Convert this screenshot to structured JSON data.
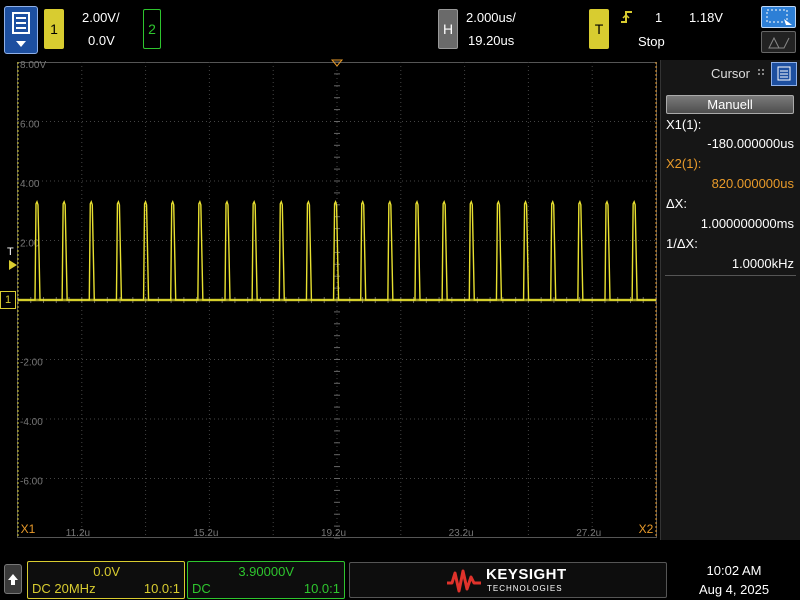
{
  "top": {
    "ch1": {
      "number": "1",
      "scale": "2.00V/",
      "offset": "0.0V"
    },
    "ch2": {
      "number": "2"
    },
    "horizontal": {
      "label": "H",
      "scale": "2.000us/",
      "delay": "19.20us"
    },
    "trigger": {
      "label": "T",
      "source": "1",
      "level": "1.18V",
      "status": "Stop"
    }
  },
  "screen": {
    "y_labels": [
      "8.00V",
      "6.00",
      "4.00",
      "2.00",
      "-2.00",
      "-4.00",
      "-6.00"
    ],
    "x_labels": [
      "11.2u",
      "15.2u",
      "19.2u",
      "23.2u",
      "27.2u"
    ],
    "marker_x1": "X1",
    "marker_x2": "X2",
    "trigger_marker": "T",
    "channel_marker": "1"
  },
  "panel": {
    "title": "Cursor",
    "mode_button": "Manuell",
    "x1_label": "X1(1):",
    "x1_value": "-180.000000us",
    "x2_label": "X2(1):",
    "x2_value": "820.000000us",
    "dx_label": "ΔX:",
    "dx_value": "1.000000000ms",
    "inv_dx_label": "1/ΔX:",
    "inv_dx_value": "1.0000kHz"
  },
  "bottom": {
    "ch1": {
      "offset": "0.0V",
      "coupling": "DC 20MHz",
      "probe": "10.0:1"
    },
    "ch2": {
      "offset": "3.90000V",
      "coupling": "DC",
      "probe": "10.0:1"
    },
    "brand": "KEYSIGHT",
    "brand_sub": "TECHNOLOGIES",
    "time": "10:02 AM",
    "date": "Aug 4, 2025"
  },
  "colors": {
    "ch1": "#d8cc30",
    "ch2": "#2ec52e",
    "x2": "#e89a2a",
    "accent": "#1d4fa0"
  },
  "waveform": {
    "channel": "1",
    "pulse_count": 23,
    "high_level_v": 3.3,
    "low_level_v": 0.0
  }
}
